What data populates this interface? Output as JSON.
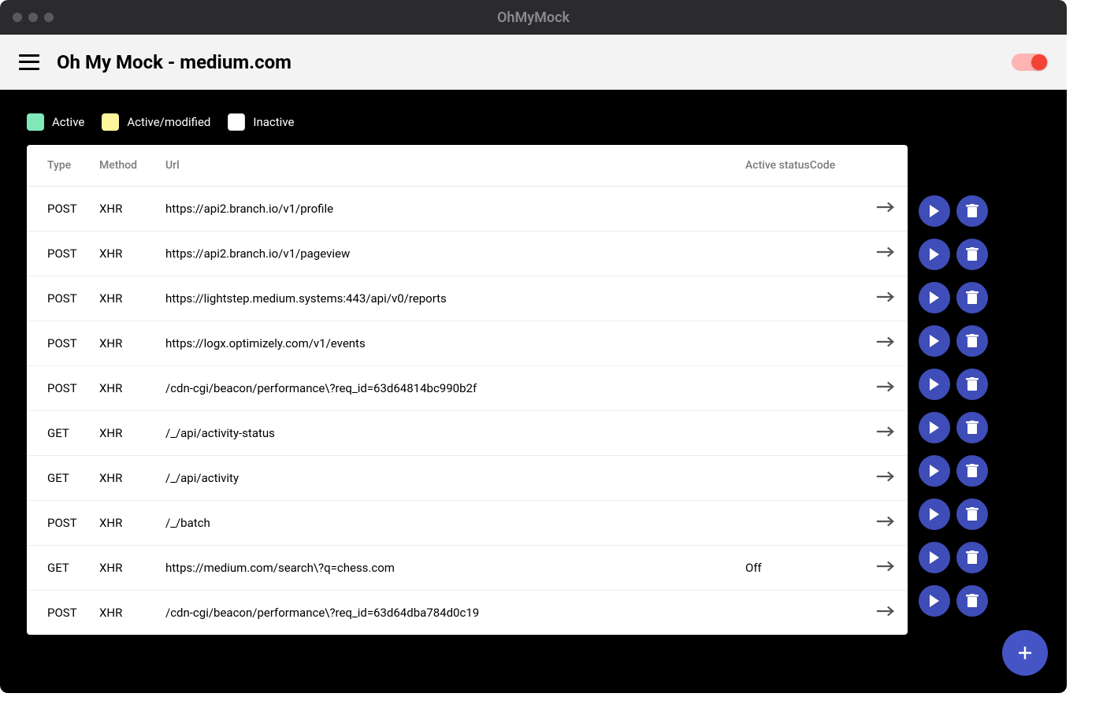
{
  "window": {
    "title": "OhMyMock"
  },
  "header": {
    "title": "Oh My Mock - medium.com",
    "toggle_on": true
  },
  "legend": [
    {
      "color": "#7fe9b9",
      "label": "Active"
    },
    {
      "color": "#fff59a",
      "label": "Active/modified"
    },
    {
      "color": "#ffffff",
      "label": "Inactive"
    }
  ],
  "table": {
    "columns": {
      "type": "Type",
      "method": "Method",
      "url": "Url",
      "status": "Active statusCode"
    },
    "rows": [
      {
        "type": "POST",
        "method": "XHR",
        "url": "https://api2.branch.io/v1/profile",
        "status": ""
      },
      {
        "type": "POST",
        "method": "XHR",
        "url": "https://api2.branch.io/v1/pageview",
        "status": ""
      },
      {
        "type": "POST",
        "method": "XHR",
        "url": "https://lightstep.medium.systems:443/api/v0/reports",
        "status": ""
      },
      {
        "type": "POST",
        "method": "XHR",
        "url": "https://logx.optimizely.com/v1/events",
        "status": ""
      },
      {
        "type": "POST",
        "method": "XHR",
        "url": "/cdn-cgi/beacon/performance\\?req_id=63d64814bc990b2f",
        "status": ""
      },
      {
        "type": "GET",
        "method": "XHR",
        "url": "/_/api/activity-status",
        "status": ""
      },
      {
        "type": "GET",
        "method": "XHR",
        "url": "/_/api/activity",
        "status": ""
      },
      {
        "type": "POST",
        "method": "XHR",
        "url": "/_/batch",
        "status": ""
      },
      {
        "type": "GET",
        "method": "XHR",
        "url": "https://medium.com/search\\?q=chess.com",
        "status": "Off"
      },
      {
        "type": "POST",
        "method": "XHR",
        "url": "/cdn-cgi/beacon/performance\\?req_id=63d64dba784d0c19",
        "status": ""
      }
    ]
  }
}
